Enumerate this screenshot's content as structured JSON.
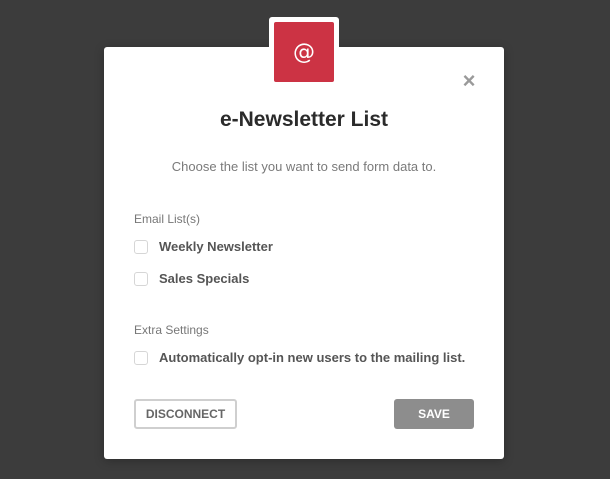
{
  "dialog": {
    "badge_icon": "at-sign-icon",
    "badge_glyph": "@",
    "badge_color": "#cc3344",
    "close_glyph": "×",
    "title": "e-Newsletter List",
    "subtitle": "Choose the list you want to send form data to."
  },
  "email_lists": {
    "label": "Email List(s)",
    "items": [
      {
        "label": "Weekly Newsletter",
        "checked": false
      },
      {
        "label": "Sales Specials",
        "checked": false
      }
    ]
  },
  "extra_settings": {
    "label": "Extra Settings",
    "items": [
      {
        "label": "Automatically opt-in new users to the mailing list.",
        "checked": false
      }
    ]
  },
  "actions": {
    "disconnect_label": "DISCONNECT",
    "save_label": "SAVE",
    "save_color": "#8d8d8d"
  }
}
